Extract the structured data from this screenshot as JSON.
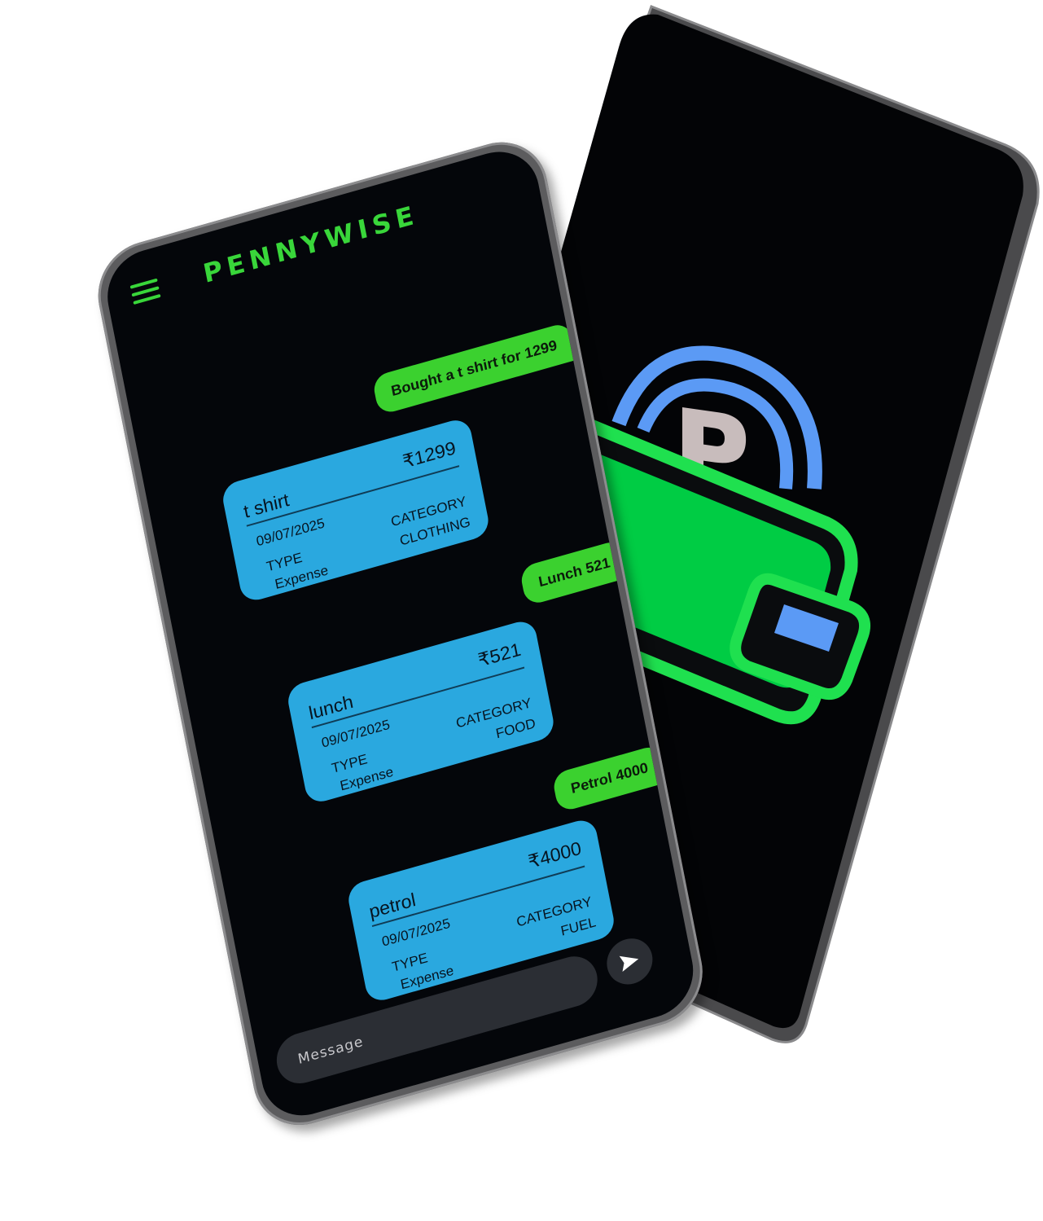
{
  "app": {
    "brand": "PENNYWISE"
  },
  "colors": {
    "accent_green": "#3bd12f",
    "card_blue": "#2aa8df",
    "logo_blue": "#5b9af5",
    "screen_black": "#04060a"
  },
  "splash": {
    "logo_letter": "P",
    "logo_icon": "wallet-icon"
  },
  "messages": [
    {
      "kind": "user",
      "text": "Bought a t shirt for 1299"
    },
    {
      "kind": "card",
      "name": "t shirt",
      "amount": "₹1299",
      "date": "09/07/2025",
      "type_label": "TYPE",
      "type_value": "Expense",
      "category_label": "CATEGORY",
      "category_value": "CLOTHING"
    },
    {
      "kind": "user",
      "text": "Lunch 521"
    },
    {
      "kind": "card",
      "name": "lunch",
      "amount": "₹521",
      "date": "09/07/2025",
      "type_label": "TYPE",
      "type_value": "Expense",
      "category_label": "CATEGORY",
      "category_value": "FOOD"
    },
    {
      "kind": "user",
      "text": "Petrol 4000"
    },
    {
      "kind": "card",
      "name": "petrol",
      "amount": "₹4000",
      "date": "09/07/2025",
      "type_label": "TYPE",
      "type_value": "Expense",
      "category_label": "CATEGORY",
      "category_value": "FUEL"
    }
  ],
  "composer": {
    "placeholder": "Message",
    "send_icon": "send-icon"
  },
  "menu_icon": "hamburger-menu-icon"
}
